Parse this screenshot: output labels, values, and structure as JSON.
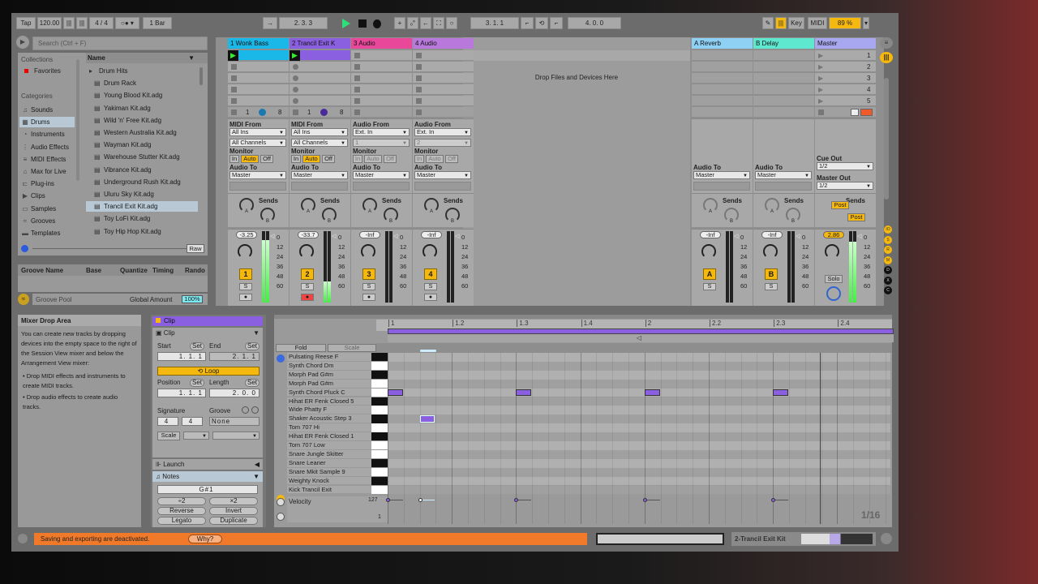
{
  "transport": {
    "tap": "Tap",
    "tempo": "120.00",
    "signature": "4 / 4",
    "quantize": "1 Bar",
    "arrangement_position": "2.  3.  3",
    "loop_start": "3.  1.  1",
    "loop_length": "4.  0.  0",
    "key": "Key",
    "midi": "MIDI",
    "cpu": "89 %"
  },
  "browser": {
    "search_placeholder": "Search (Ctrl + F)",
    "collections_label": "Collections",
    "favorites": "Favorites",
    "categories_label": "Categories",
    "categories": [
      "Sounds",
      "Drums",
      "Instruments",
      "Audio Effects",
      "MIDI Effects",
      "Max for Live",
      "Plug-ins",
      "Clips",
      "Samples",
      "Grooves",
      "Templates"
    ],
    "selected_category": "Drums",
    "name_header": "Name",
    "items": [
      "Drum Hits",
      "Drum Rack",
      "Young Blood Kit.adg",
      "Yakiman Kit.adg",
      "Wild 'n' Free Kit.adg",
      "Western Australia Kit.adg",
      "Wayman Kit.adg",
      "Warehouse Stutter Kit.adg",
      "Vibrance Kit.adg",
      "Underground Rush Kit.adg",
      "Uluru Sky Kit.adg",
      "Trancil Exit Kit.adg",
      "Toy LoFi Kit.adg",
      "Toy Hip Hop Kit.adg"
    ],
    "selected_item": "Trancil Exit Kit.adg",
    "raw": "Raw"
  },
  "groove": {
    "headers": [
      "Groove Name",
      "Base",
      "Quantize",
      "Timing",
      "Rando"
    ],
    "pool": "Groove Pool",
    "global_amount_label": "Global Amount",
    "global_amount": "100%"
  },
  "session": {
    "drop_text": "Drop Files and Devices Here",
    "tracks": [
      {
        "name": "1 Wonk Bass",
        "color": "#1ab8e8",
        "type": "midi",
        "from_label": "MIDI From",
        "from": "All Ins",
        "channel": "All Channels",
        "volume": "-3.25",
        "number": "1",
        "meter": 0.88,
        "playing": true,
        "range_lo": "1",
        "range_hi": "8"
      },
      {
        "name": "2 Trancil Exit K",
        "color": "#8a5fe0",
        "type": "midi",
        "from_label": "MIDI From",
        "from": "All Ins",
        "channel": "All Channels",
        "volume": "-33.7",
        "number": "2",
        "meter": 0.3,
        "playing": true,
        "armed": true,
        "range_lo": "1",
        "range_hi": "8"
      },
      {
        "name": "3 Audio",
        "color": "#e8479a",
        "type": "audio",
        "from_label": "Audio From",
        "from": "Ext. In",
        "channel": "1",
        "volume": "-Inf",
        "number": "3",
        "meter": 0
      },
      {
        "name": "4 Audio",
        "color": "#b878dc",
        "type": "audio",
        "from_label": "Audio From",
        "from": "Ext. In",
        "channel": "2",
        "volume": "-Inf",
        "number": "4",
        "meter": 0
      }
    ],
    "returns": [
      {
        "name": "A Reverb",
        "color": "#8fd0f5",
        "volume": "-Inf",
        "letter": "A"
      },
      {
        "name": "B Delay",
        "color": "#5fe8d0",
        "volume": "-Inf",
        "letter": "B"
      }
    ],
    "master": {
      "name": "Master",
      "color": "#a8a8f0",
      "scenes": [
        "1",
        "2",
        "3",
        "4",
        "5"
      ],
      "cue_out_label": "Cue Out",
      "cue_out": "1/2",
      "master_out_label": "Master Out",
      "master_out": "1/2",
      "post": "Post",
      "volume": "2.86",
      "solo": "Solo"
    },
    "labels": {
      "monitor": "Monitor",
      "in": "In",
      "auto": "Auto",
      "off": "Off",
      "audio_to": "Audio To",
      "master": "Master",
      "sends": "Sends",
      "s": "S",
      "a": "A",
      "b": "B"
    },
    "meter_scale": [
      "0",
      "12",
      "24",
      "36",
      "48",
      "60"
    ],
    "side_buttons": [
      "IO",
      "S",
      "R",
      "M",
      "D",
      "X",
      "C"
    ]
  },
  "info": {
    "title": "Mixer Drop Area",
    "body": "You can create new tracks by dropping devices into the empty space to the right of the Session View mixer and below the Arrangement View mixer:",
    "bullets": [
      "Drop MIDI effects and instruments to create MIDI tracks.",
      "Drop audio effects to create audio tracks."
    ]
  },
  "clip": {
    "title": "Clip",
    "section": "Clip",
    "start_label": "Start",
    "end_label": "End",
    "set": "Set",
    "start": "1.  1.  1",
    "end": "2.  1.  1",
    "loop": "Loop",
    "position_label": "Position",
    "length_label": "Length",
    "position": "1.  1.  1",
    "length": "2.  0.  0",
    "signature_label": "Signature",
    "groove_label": "Groove",
    "sig_num": "4",
    "sig_den": "4",
    "groove": "None",
    "scale": "Scale",
    "launch": "Launch",
    "notes": "Notes",
    "note_value": "G#1",
    "half": "÷2",
    "double": "×2",
    "reverse": "Reverse",
    "invert": "Invert",
    "legato": "Legato",
    "duplicate": "Duplicate"
  },
  "piano": {
    "fold": "Fold",
    "scale": "Scale",
    "velocity": "Velocity",
    "vel_max": "127",
    "vel_min": "1",
    "grid": "1/16",
    "ruler": [
      {
        "label": "1",
        "beat": 0
      },
      {
        "label": "1.2",
        "beat": 1
      },
      {
        "label": "1.3",
        "beat": 2
      },
      {
        "label": "1.4",
        "beat": 3
      },
      {
        "label": "2",
        "beat": 4
      },
      {
        "label": "2.2",
        "beat": 5
      },
      {
        "label": "2.3",
        "beat": 6
      },
      {
        "label": "2.4",
        "beat": 7
      }
    ],
    "rows": [
      {
        "name": "Pulsating Reese F",
        "black": true
      },
      {
        "name": "Synth Chord Dm",
        "black": false
      },
      {
        "name": "Morph Pad G#m",
        "black": true
      },
      {
        "name": "Morph Pad G#m",
        "black": false
      },
      {
        "name": "Synth Chord Pluck C",
        "black": false
      },
      {
        "name": "Hihat ER Fenk Closed 5",
        "black": true
      },
      {
        "name": "Wide Phatty F",
        "black": false
      },
      {
        "name": "Shaker Acoustic Step 3",
        "black": true
      },
      {
        "name": "Tom 707 Hi",
        "black": false
      },
      {
        "name": "Hihat ER Fenk Closed 1",
        "black": true
      },
      {
        "name": "Tom 707 Low",
        "black": false
      },
      {
        "name": "Snare Jungle Skitter",
        "black": false
      },
      {
        "name": "Snare Leaner",
        "black": true
      },
      {
        "name": "Snare Mkit Sample 9",
        "black": false
      },
      {
        "name": "Weighty Knock",
        "black": true
      },
      {
        "name": "Kick Trancil Exit",
        "black": false
      }
    ],
    "notes": [
      {
        "row": 4,
        "start": 0,
        "length": 0.25,
        "velocity": 127
      },
      {
        "row": 4,
        "start": 2,
        "length": 0.25,
        "velocity": 127
      },
      {
        "row": 4,
        "start": 4,
        "length": 0.25,
        "velocity": 127
      },
      {
        "row": 4,
        "start": 6,
        "length": 0.25,
        "velocity": 127
      },
      {
        "row": 7,
        "start": 0.5,
        "length": 0.25,
        "velocity": 127,
        "selected": true
      }
    ],
    "clip_end_beat": 6.75
  },
  "status": {
    "message": "Saving and exporting are deactivated.",
    "why": "Why?",
    "track": "2-Trancil Exit Kit"
  },
  "colors": {
    "accent": "#f5b80f",
    "clip_purple": "#8a5fe0",
    "status_orange": "#f07a2a"
  }
}
